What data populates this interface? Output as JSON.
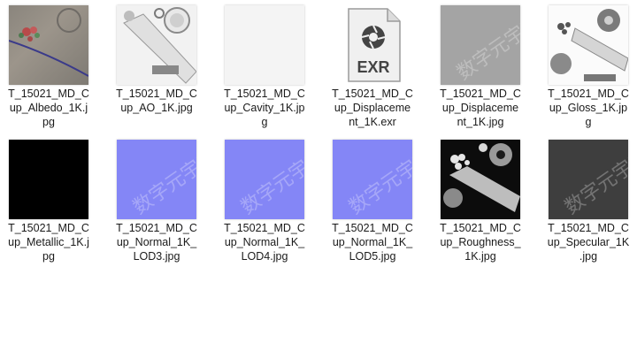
{
  "files": [
    {
      "name_line1": "T_15021_MD_C",
      "name_line2": "up_Albedo_1K.j",
      "name_line3": "pg",
      "icon": "image-thumbnail-albedo"
    },
    {
      "name_line1": "T_15021_MD_C",
      "name_line2": "up_AO_1K.jpg",
      "name_line3": "",
      "icon": "image-thumbnail-ao"
    },
    {
      "name_line1": "T_15021_MD_C",
      "name_line2": "up_Cavity_1K.jp",
      "name_line3": "g",
      "icon": "image-thumbnail-cavity"
    },
    {
      "name_line1": "T_15021_MD_C",
      "name_line2": "up_Displaceme",
      "name_line3": "nt_1K.exr",
      "icon": "exr-file-icon",
      "badge": "EXR"
    },
    {
      "name_line1": "T_15021_MD_C",
      "name_line2": "up_Displaceme",
      "name_line3": "nt_1K.jpg",
      "icon": "image-thumbnail-displacement"
    },
    {
      "name_line1": "T_15021_MD_C",
      "name_line2": "up_Gloss_1K.jp",
      "name_line3": "g",
      "icon": "image-thumbnail-gloss"
    },
    {
      "name_line1": "T_15021_MD_C",
      "name_line2": "up_Metallic_1K.j",
      "name_line3": "pg",
      "icon": "image-thumbnail-metallic"
    },
    {
      "name_line1": "T_15021_MD_C",
      "name_line2": "up_Normal_1K_",
      "name_line3": "LOD3.jpg",
      "icon": "image-thumbnail-normal"
    },
    {
      "name_line1": "T_15021_MD_C",
      "name_line2": "up_Normal_1K_",
      "name_line3": "LOD4.jpg",
      "icon": "image-thumbnail-normal"
    },
    {
      "name_line1": "T_15021_MD_C",
      "name_line2": "up_Normal_1K_",
      "name_line3": "LOD5.jpg",
      "icon": "image-thumbnail-normal"
    },
    {
      "name_line1": "T_15021_MD_C",
      "name_line2": "up_Roughness_",
      "name_line3": "1K.jpg",
      "icon": "image-thumbnail-roughness"
    },
    {
      "name_line1": "T_15021_MD_C",
      "name_line2": "up_Specular_1K",
      "name_line3": ".jpg",
      "icon": "image-thumbnail-specular"
    }
  ],
  "colors": {
    "normal_map": "#8486f6",
    "exr_icon_bg": "#6e6e6e"
  }
}
